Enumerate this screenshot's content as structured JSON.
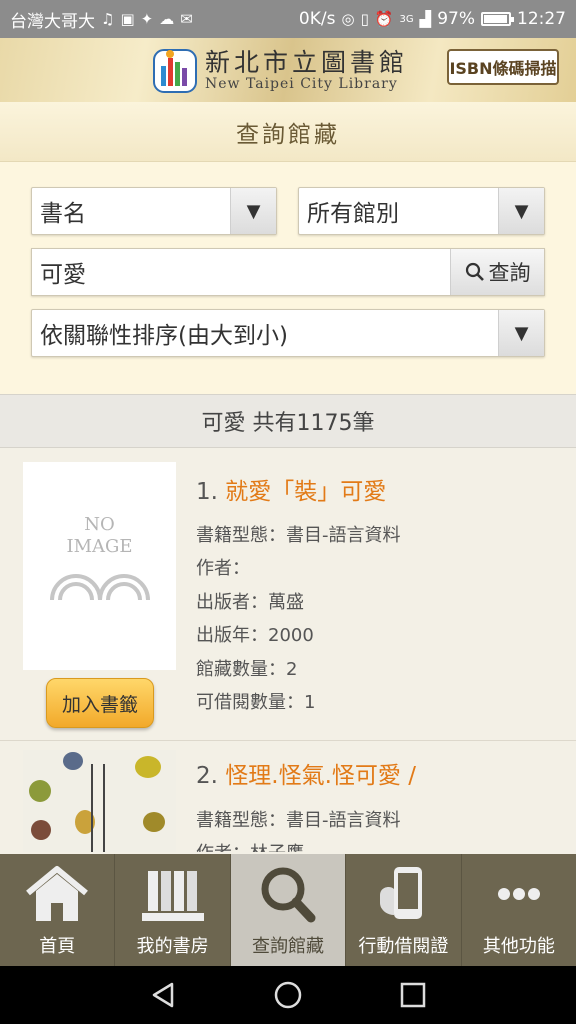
{
  "status_bar": {
    "carrier": "台灣大哥大",
    "speed": "0K/s",
    "signal_label": "3G",
    "battery": "97%",
    "battery_level": 0.97,
    "time": "12:27"
  },
  "header": {
    "library_name": "新北市立圖書館",
    "library_name_en": "New Taipei City Library",
    "isbn_button": "ISBN條碼掃描"
  },
  "page_title": "查詢館藏",
  "search": {
    "field_select": "書名",
    "branch_select": "所有館別",
    "query": "可愛",
    "search_button": "查詢",
    "sort_select": "依關聯性排序(由大到小)"
  },
  "results": {
    "summary": "可愛 共有1175筆",
    "items": [
      {
        "index": "1.",
        "title": "就愛「裝」可愛",
        "no_image_line1": "NO",
        "no_image_line2": "IMAGE",
        "type": "書籍型態：書目-語言資料",
        "author": "作者：",
        "publisher": "出版者：萬盛",
        "year": "出版年：2000",
        "holdings": "館藏數量：2",
        "available": "可借閱數量：1",
        "bookmark_button": "加入書籤"
      },
      {
        "index": "2.",
        "title": "怪理.怪氣.怪可愛 /",
        "type": "書籍型態：書目-語言資料",
        "author": "作者：林子鷹"
      }
    ]
  },
  "bottom_nav": [
    {
      "label": "首頁",
      "icon": "home-icon"
    },
    {
      "label": "我的書房",
      "icon": "books-icon"
    },
    {
      "label": "查詢館藏",
      "icon": "search-icon"
    },
    {
      "label": "行動借閱證",
      "icon": "phone-card-icon"
    },
    {
      "label": "其他功能",
      "icon": "more-icon"
    }
  ],
  "colors": {
    "accent_orange": "#e27a17",
    "nav_bg": "#6d6650",
    "nav_active": "#c9c6be"
  }
}
